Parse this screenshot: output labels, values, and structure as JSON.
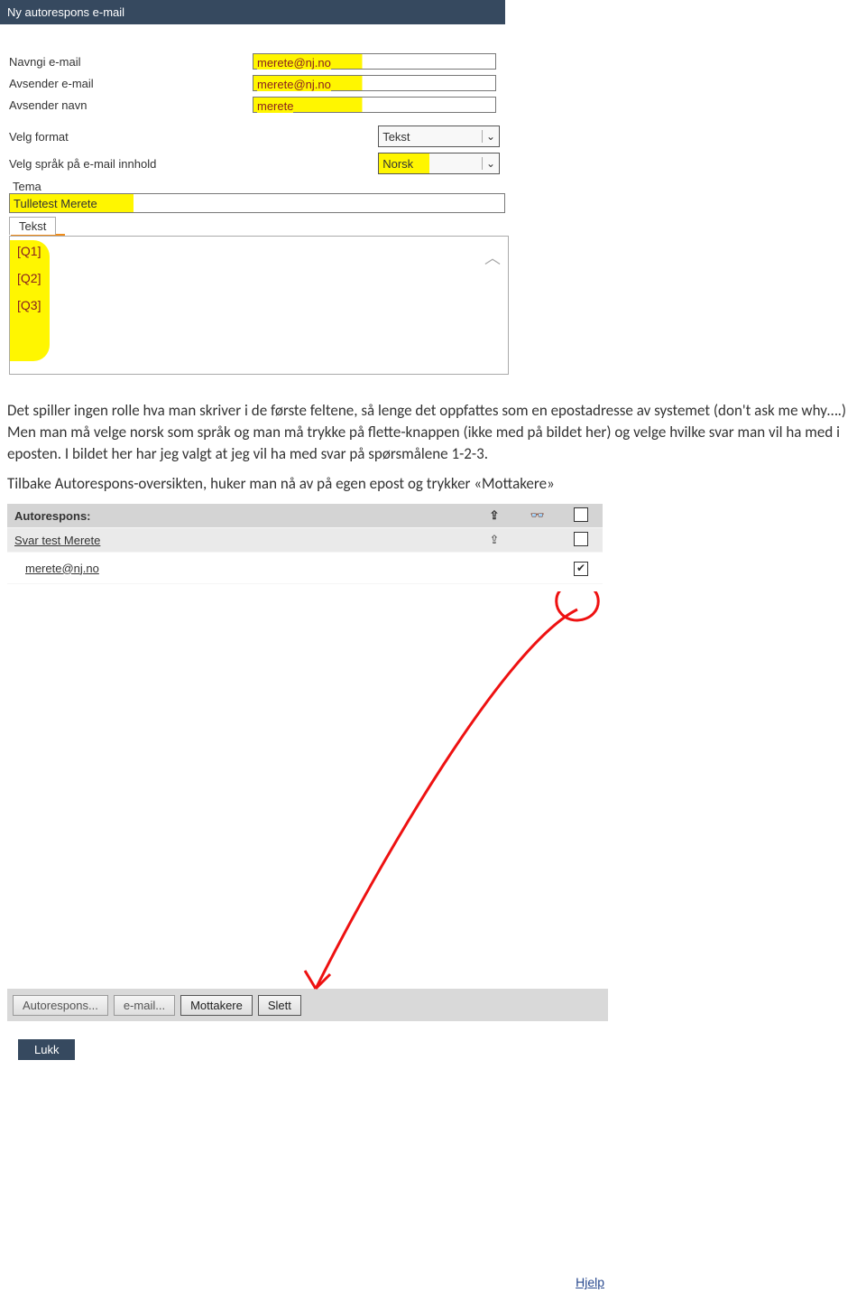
{
  "titlebar": "Ny autorespons e-mail",
  "form": {
    "navngi_label": "Navngi e-mail",
    "navngi_value": "merete@nj.no",
    "avsender_email_label": "Avsender e-mail",
    "avsender_email_value": "merete@nj.no",
    "avsender_navn_label": "Avsender navn",
    "avsender_navn_value": "merete",
    "format_label": "Velg format",
    "format_value": "Tekst",
    "sprak_label": "Velg språk på e-mail innhold",
    "sprak_value": "Norsk",
    "tema_label": "Tema",
    "tema_value": "Tulletest Merete",
    "tab_tekst": "Tekst",
    "editor": {
      "q1": "[Q1]",
      "q2": "[Q2]",
      "q3": "[Q3]"
    }
  },
  "para1": "Det spiller ingen rolle hva man skriver i de første feltene, så lenge det oppfattes som en epostadresse av systemet (don't ask me why….) Men man må velge norsk som språk og man må trykke på flette-knappen (ikke med på bildet her) og velge hvilke svar man vil ha med i eposten. I bildet her har jeg valgt at jeg vil ha med svar på spørsmålene 1-2-3.",
  "para2": "Tilbake Autorespons-oversikten, huker man nå av på egen epost og trykker «Mottakere»",
  "list": {
    "header": "Autorespons:",
    "glyph1": "⇪",
    "glyph2": "👓",
    "row1_name": "Svar test Merete",
    "row2_name": "merete@nj.no"
  },
  "buttons": {
    "autorespons": "Autorespons...",
    "email": "e-mail...",
    "mottakere": "Mottakere",
    "slett": "Slett",
    "lukk": "Lukk",
    "hjelp": "Hjelp"
  }
}
